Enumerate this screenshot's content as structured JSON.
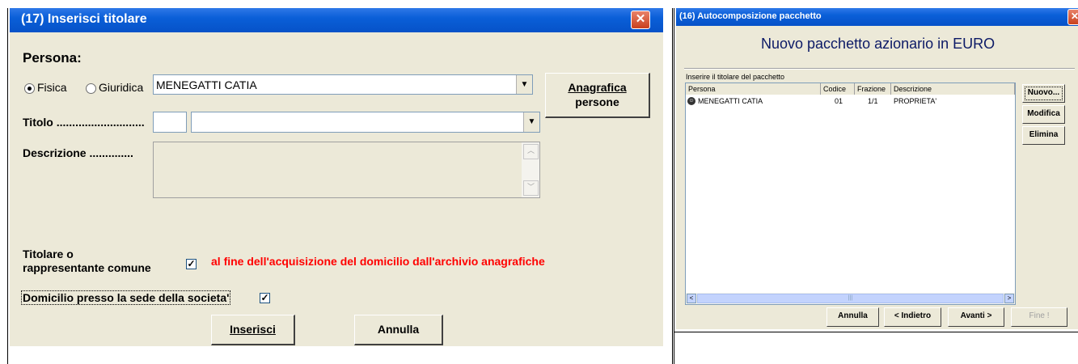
{
  "dialog1": {
    "title": "(17) Inserisci titolare",
    "close": "✕",
    "persona_label": "Persona:",
    "radio_fisica": "Fisica",
    "radio_giuridica": "Giuridica",
    "persona_value": "MENEGATTI CATIA",
    "anagrafica_line1": "Anagrafica",
    "anagrafica_line2": "persone",
    "titolo_label": "Titolo ............................",
    "descrizione_label": "Descrizione ..............",
    "titolare_line1": "Titolare o",
    "titolare_line2": "rappresentante comune",
    "red_note": "al fine dell'acquisizione del domicilio dall'archivio anagrafiche",
    "domicilio_label": "Domicilio presso la sede della societa'",
    "inserisci": "Inserisci",
    "annulla": "Annulla",
    "dropdown_arrow": "▼",
    "scroll_up": "︿",
    "scroll_down": "﹀",
    "check": "✓"
  },
  "dialog2": {
    "title": "(16) Autocomposizione pacchetto",
    "heading": "Nuovo pacchetto azionario in EURO",
    "list_caption": "Inserire il titolare del pacchetto",
    "columns": [
      "Persona",
      "Codice",
      "Frazione",
      "Descrizione"
    ],
    "row": {
      "persona": "MENEGATTI CATIA",
      "codice": "01",
      "frazione": "1/1",
      "descrizione": "PROPRIETA'"
    },
    "side_buttons": {
      "nuovo": "Nuovo...",
      "modifica": "Modifica",
      "elimina": "Elimina"
    },
    "bottom_buttons": {
      "annulla": "Annulla",
      "indietro": "< Indietro",
      "avanti": "Avanti >",
      "fine": "Fine !"
    },
    "scroll_left": "<",
    "scroll_right": ">",
    "scroll_grip": "|||"
  },
  "colors": {
    "titlebar": "#0a5fd8",
    "dialog_bg": "#ece9d8",
    "red_note": "#ff0000"
  }
}
